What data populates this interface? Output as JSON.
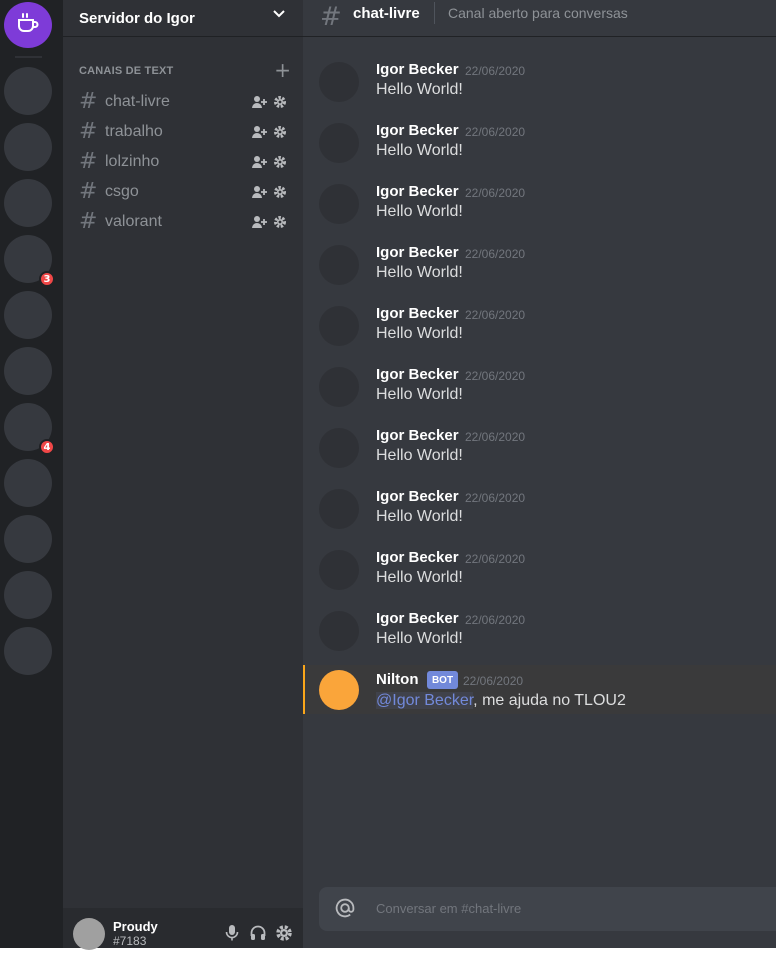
{
  "servers": {
    "home_icon": "coffee-cup-icon",
    "accent": "#7e3bd8",
    "badges": [
      "3",
      "4"
    ]
  },
  "sidebar": {
    "server_name": "Servidor do Igor",
    "category_label": "CANAIS DE TEXT",
    "channels": [
      {
        "label": "chat-livre"
      },
      {
        "label": "trabalho"
      },
      {
        "label": "lolzinho"
      },
      {
        "label": "csgo"
      },
      {
        "label": "valorant"
      }
    ]
  },
  "user": {
    "name": "Proudy",
    "tag": "#7183"
  },
  "header": {
    "channel_name": "chat-livre",
    "topic": "Canal aberto para conversas"
  },
  "messages": [
    {
      "author": "Igor Becker",
      "time": "22/06/2020",
      "text": "Hello World!"
    },
    {
      "author": "Igor Becker",
      "time": "22/06/2020",
      "text": "Hello World!"
    },
    {
      "author": "Igor Becker",
      "time": "22/06/2020",
      "text": "Hello World!"
    },
    {
      "author": "Igor Becker",
      "time": "22/06/2020",
      "text": "Hello World!"
    },
    {
      "author": "Igor Becker",
      "time": "22/06/2020",
      "text": "Hello World!"
    },
    {
      "author": "Igor Becker",
      "time": "22/06/2020",
      "text": "Hello World!"
    },
    {
      "author": "Igor Becker",
      "time": "22/06/2020",
      "text": "Hello World!"
    },
    {
      "author": "Igor Becker",
      "time": "22/06/2020",
      "text": "Hello World!"
    },
    {
      "author": "Igor Becker",
      "time": "22/06/2020",
      "text": "Hello World!"
    },
    {
      "author": "Igor Becker",
      "time": "22/06/2020",
      "text": "Hello World!"
    }
  ],
  "mention_message": {
    "author": "Nilton",
    "bot_tag": "BOT",
    "time": "22/06/2020",
    "mention": "@Igor Becker",
    "text": ", me ajuda no TLOU2",
    "highlight_color": "#faa61a"
  },
  "composer": {
    "placeholder": "Conversar em #chat-livre"
  }
}
